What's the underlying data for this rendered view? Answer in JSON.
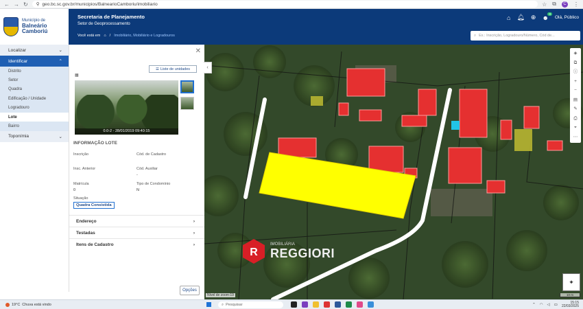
{
  "browser": {
    "url": "geo.bc.sc.gov.br/municipios/BalnearioCamboriu/imobiliario",
    "profile_initial": "C"
  },
  "logo": {
    "line1": "Município de",
    "line2": "Balneário",
    "line3": "Camboriú"
  },
  "header": {
    "title": "Secretaria de Planejamento",
    "subtitle": "Setor de Geoprocessamento",
    "breadcrumb_prefix": "Você está em",
    "breadcrumb_sep": "/",
    "breadcrumb_link": "Imobiliário, Mobiliário e Logradouros",
    "user_greeting": "Olá, Público",
    "notification_count": "0",
    "search_placeholder": "Ex.: Inscrição, Logradouro/Número, Cód de..."
  },
  "menu": {
    "localizar": "Localizar",
    "identificar": "Identificar",
    "sub_items": [
      "Distrito",
      "Setor",
      "Quadra",
      "Edificação / Unidade",
      "Logradouro",
      "Lote",
      "Bairro"
    ],
    "toponimia": "Toponímia"
  },
  "panel": {
    "units_button": "Liste de unidades",
    "photo_caption": "0.0-2 - 28/01/2019 09:40:15",
    "section_title": "INFORMAÇÃO LOTE",
    "fields": {
      "inscricao_label": "Inscrição",
      "cod_cadastro_label": "Cód. de Cadastro",
      "insc_anterior_label": "Insc. Anterior",
      "cod_auxiliar_label": "Cód. Auxiliar",
      "cod_auxiliar_value": "-",
      "matricula_label": "Matrícula",
      "matricula_value": "0",
      "tipo_condominio_label": "Tipo de Condomínio",
      "tipo_condominio_value": "N",
      "situacao_label": "Situação"
    },
    "status": "Quadra Consistida",
    "accordions": [
      "Endereço",
      "Testadas",
      "Itens de Cadastro"
    ],
    "options_button": "Opções"
  },
  "map": {
    "zoom_text": "Nível de zoom:19",
    "scale_text": "10 m",
    "watermark": "REGGIORI",
    "watermark_sub": "IMOBILIÁRIA"
  },
  "taskbar": {
    "weather_temp": "19°C",
    "weather_desc": "Chuva está vindo",
    "search_label": "Pesquisar",
    "time": "15:15",
    "date": "22/03/2025"
  }
}
